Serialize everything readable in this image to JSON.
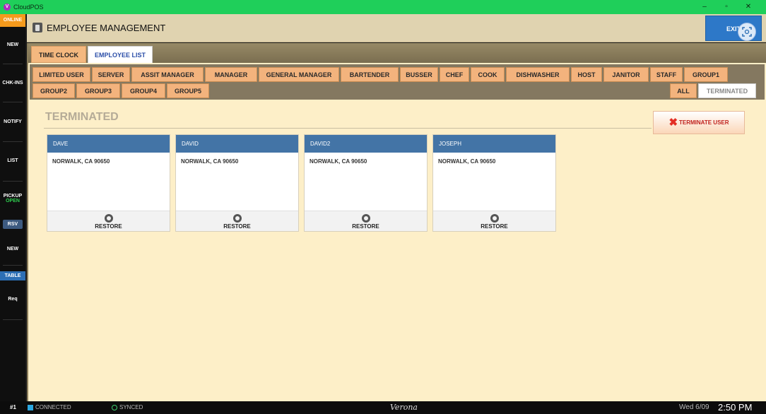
{
  "titlebar": {
    "app_name": "CloudPOS"
  },
  "sidebar": {
    "online": "ONLINE",
    "items": [
      {
        "label": "NEW"
      },
      {
        "label": "CHK-INS"
      },
      {
        "label": "NOTIFY"
      },
      {
        "label": "LIST"
      },
      {
        "label": "PICKUP",
        "sub": "OPEN"
      },
      {
        "label": "RSV"
      },
      {
        "label": "NEW"
      },
      {
        "label": "TABLE"
      },
      {
        "label": "Req"
      }
    ]
  },
  "header": {
    "title": "EMPLOYEE MANAGEMENT",
    "exit_label": "EXIT"
  },
  "tabs": [
    {
      "label": "TIME CLOCK",
      "active": false
    },
    {
      "label": "EMPLOYEE LIST",
      "active": true
    }
  ],
  "filters": {
    "row1": [
      "LIMITED USER",
      "SERVER",
      "ASSIT MANAGER",
      "MANAGER",
      "GENERAL MANAGER",
      "BARTENDER",
      "BUSSER",
      "CHEF",
      "COOK",
      "DISHWASHER",
      "HOST",
      "JANITOR",
      "STAFF",
      "GROUP1"
    ],
    "row2": [
      "GROUP2",
      "GROUP3",
      "GROUP4",
      "GROUP5"
    ],
    "right": [
      "ALL",
      "TERMINATED"
    ],
    "selected": "TERMINATED"
  },
  "section": {
    "title": "TERMINATED"
  },
  "terminate_button": {
    "label": "TERMINATE USER"
  },
  "employees": [
    {
      "name": "DAVE",
      "address": "NORWALK, CA 90650",
      "action": "RESTORE"
    },
    {
      "name": "DAVID",
      "address": "NORWALK, CA 90650",
      "action": "RESTORE"
    },
    {
      "name": "DAVID2",
      "address": "NORWALK, CA 90650",
      "action": "RESTORE"
    },
    {
      "name": "JOSEPH",
      "address": "NORWALK, CA 90650",
      "action": "RESTORE"
    }
  ],
  "statusbar": {
    "station": "#1",
    "connected": "CONNECTED",
    "synced": "SYNCED",
    "location": "Verona",
    "date": "Wed 6/09",
    "time": "2:50 PM"
  },
  "colors": {
    "accent": "#2d78c8",
    "tab_orange": "#f3b37d",
    "card_header": "#4374a6",
    "titlebar": "#1fcf5a"
  }
}
